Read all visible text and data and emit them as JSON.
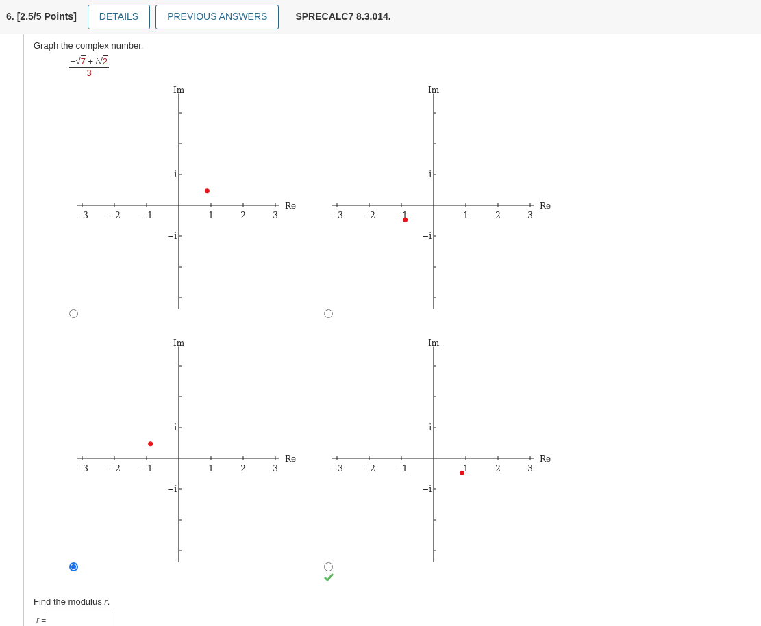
{
  "header": {
    "number": "6.",
    "points": "[2.5/5 Points]",
    "buttons": [
      "DETAILS",
      "PREVIOUS ANSWERS"
    ],
    "code": "SPRECALC7 8.3.014."
  },
  "prompt": "Graph the complex number.",
  "fraction": {
    "numerator": [
      {
        "text": "−",
        "kind": "op"
      },
      {
        "text": "√",
        "kind": "radical"
      },
      {
        "text": "7",
        "kind": "value"
      },
      {
        "text": " + ",
        "kind": "op"
      },
      {
        "text": "i",
        "kind": "unit"
      },
      {
        "text": "√",
        "kind": "radical"
      },
      {
        "text": "2",
        "kind": "value"
      }
    ],
    "denominator": "3"
  },
  "options": [
    {
      "selected": false,
      "correct": false,
      "graph": {
        "re_label": "Re",
        "im_label": "Im",
        "re_ticks": [
          "−3",
          "−2",
          "−1",
          "1",
          "2",
          "3"
        ],
        "im_ticks": [
          "i",
          "−i"
        ],
        "point_right": true,
        "point_above": true
      }
    },
    {
      "selected": false,
      "correct": false,
      "graph": {
        "re_label": "Re",
        "im_label": "Im",
        "re_ticks": [
          "−3",
          "−2",
          "−1",
          "1",
          "2",
          "3"
        ],
        "im_ticks": [
          "i",
          "−i"
        ],
        "point_right": false,
        "point_above": false
      }
    },
    {
      "selected": true,
      "correct": false,
      "graph": {
        "re_label": "Re",
        "im_label": "Im",
        "re_ticks": [
          "−3",
          "−2",
          "−1",
          "1",
          "2",
          "3"
        ],
        "im_ticks": [
          "i",
          "−i"
        ],
        "point_right": false,
        "point_above": true
      }
    },
    {
      "selected": false,
      "correct": true,
      "graph": {
        "re_label": "Re",
        "im_label": "Im",
        "re_ticks": [
          "−3",
          "−2",
          "−1",
          "1",
          "2",
          "3"
        ],
        "im_ticks": [
          "i",
          "−i"
        ],
        "point_right": true,
        "point_above": false
      }
    }
  ],
  "modulus": {
    "prompt": "Find the modulus *r*.",
    "label": "*r* ="
  }
}
